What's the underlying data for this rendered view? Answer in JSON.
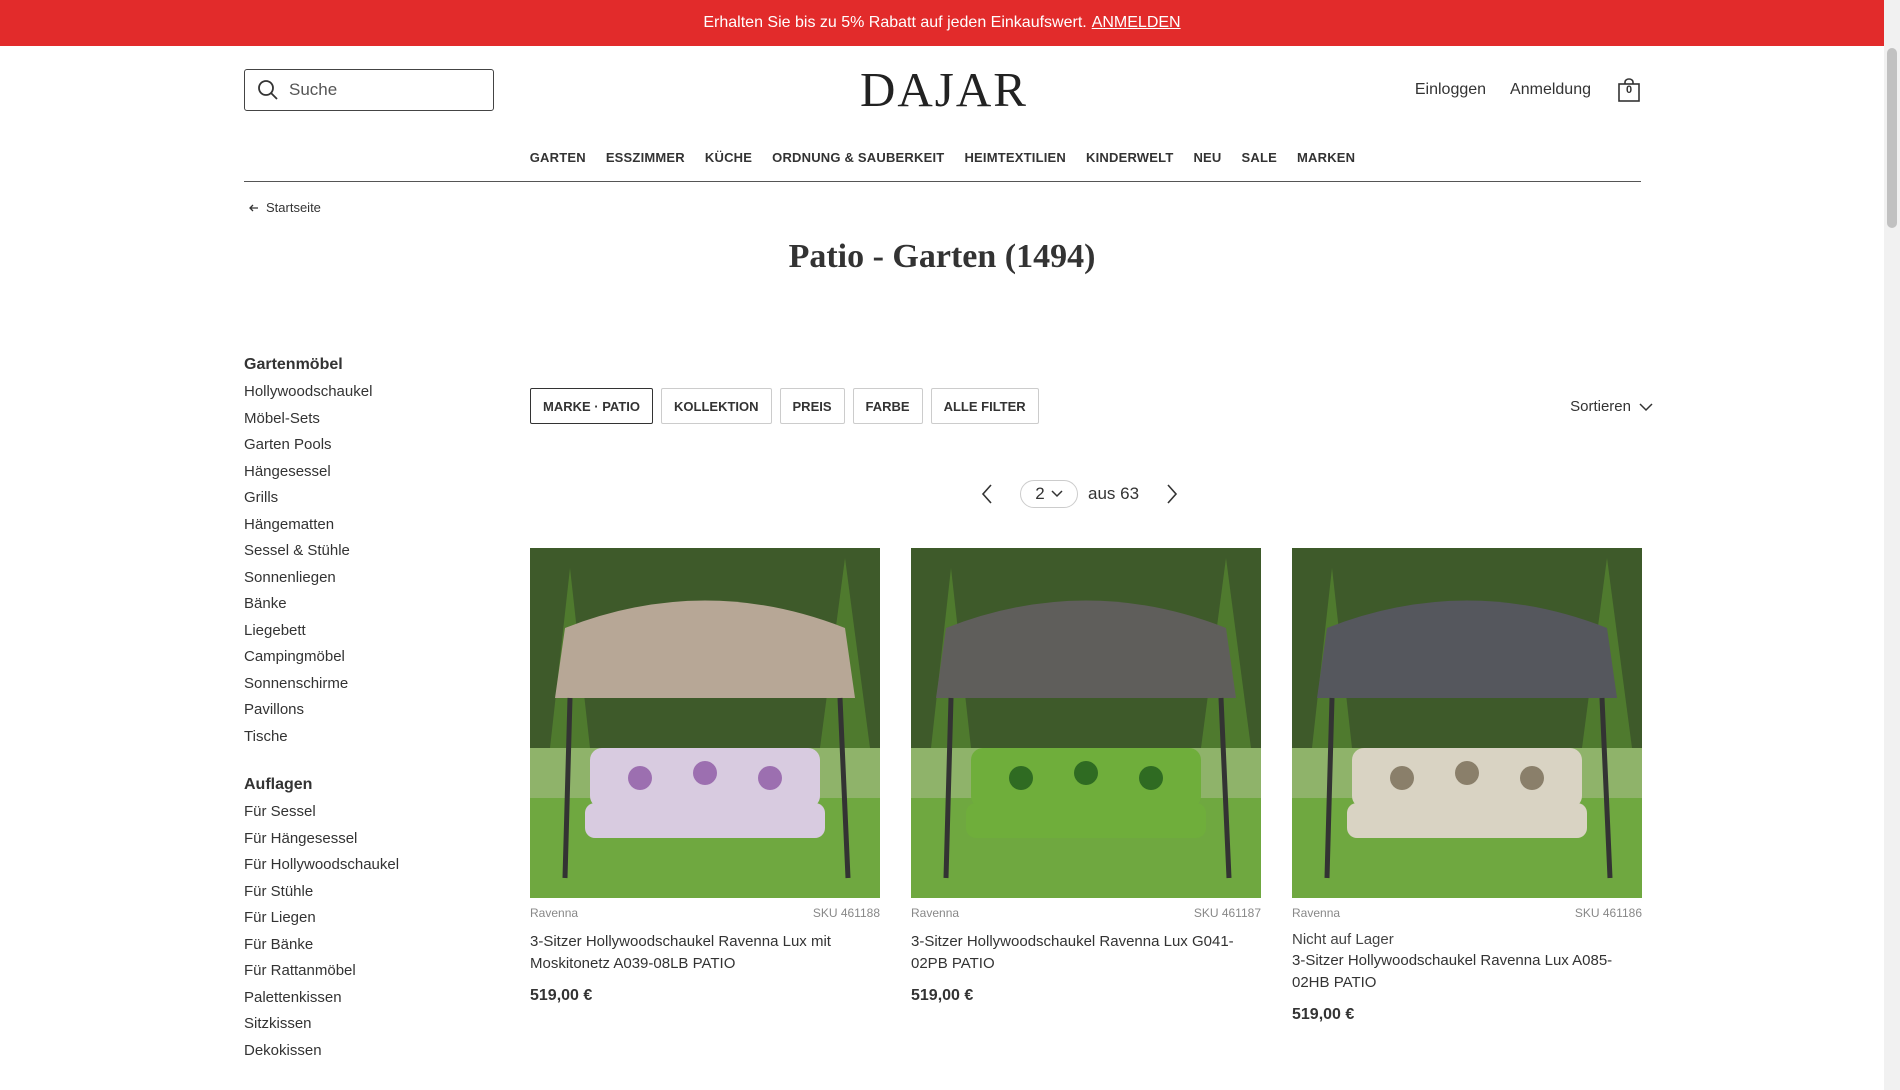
{
  "promo": {
    "text": "Erhalten Sie bis zu 5% Rabatt auf jeden Einkaufswert.",
    "link": "ANMELDEN"
  },
  "header": {
    "search_placeholder": "Suche",
    "logo": "DAJAR",
    "login": "Einloggen",
    "register": "Anmeldung",
    "cart_count": "0"
  },
  "nav": [
    "GARTEN",
    "ESSZIMMER",
    "KÜCHE",
    "ORDNUNG & SAUBERKEIT",
    "HEIMTEXTILIEN",
    "KINDERWELT",
    "NEU",
    "SALE",
    "MARKEN"
  ],
  "breadcrumb": "Startseite",
  "page_title": "Patio - Garten (1494)",
  "sidebar": {
    "groups": [
      {
        "title": "Gartenmöbel",
        "items": [
          "Hollywoodschaukel",
          "Möbel-Sets",
          "Garten Pools",
          "Hängesessel",
          "Grills",
          "Hängematten",
          "Sessel & Stühle",
          "Sonnenliegen",
          "Bänke",
          "Liegebett",
          "Campingmöbel",
          "Sonnenschirme",
          "Pavillons",
          "Tische"
        ]
      },
      {
        "title": "Auflagen",
        "items": [
          "Für Sessel",
          "Für Hängesessel",
          "Für Hollywoodschaukel",
          "Für Stühle",
          "Für Liegen",
          "Für Bänke",
          "Für Rattanmöbel",
          "Palettenkissen",
          "Sitzkissen",
          "Dekokissen"
        ]
      }
    ]
  },
  "filters": [
    "MARKE · PATIO",
    "KOLLEKTION",
    "PREIS",
    "FARBE",
    "ALLE FILTER"
  ],
  "sort_label": "Sortieren",
  "pagination": {
    "current": "2",
    "total": "aus 63"
  },
  "products": [
    {
      "brand": "Ravenna",
      "sku": "SKU 461188",
      "stock": "",
      "title": "3-Sitzer Hollywoodschaukel Ravenna Lux mit Moskitonetz A039-08LB PATIO",
      "price": "519,00 €",
      "canopy_color": "#b7a796",
      "cushion_color": "#d8cbe0",
      "accent_color": "#9c6fb0"
    },
    {
      "brand": "Ravenna",
      "sku": "SKU 461187",
      "stock": "",
      "title": "3-Sitzer Hollywoodschaukel Ravenna Lux G041-02PB PATIO",
      "price": "519,00 €",
      "canopy_color": "#5f5e5b",
      "cushion_color": "#6fae3b",
      "accent_color": "#2f6b22"
    },
    {
      "brand": "Ravenna",
      "sku": "SKU 461186",
      "stock": "Nicht auf Lager",
      "title": "3-Sitzer Hollywoodschaukel Ravenna Lux A085-02HB PATIO",
      "price": "519,00 €",
      "canopy_color": "#55575d",
      "cushion_color": "#d9d3c3",
      "accent_color": "#8a7f6a"
    }
  ]
}
